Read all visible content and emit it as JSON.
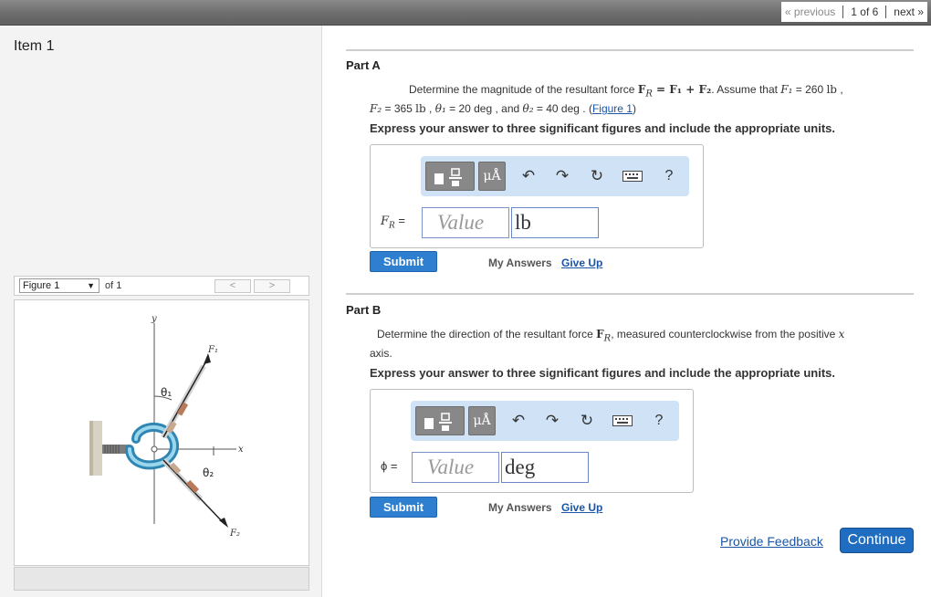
{
  "pager": {
    "previous": "« previous",
    "count": "1 of 6",
    "next": "next »"
  },
  "item": {
    "title": "Item 1"
  },
  "figure": {
    "select_value": "Figure 1",
    "of_label": "of 1",
    "prev": "<",
    "next": ">",
    "labels": {
      "y": "y",
      "x": "x",
      "f1": "F₁",
      "f2": "F₂",
      "theta1": "θ₁",
      "theta2": "θ₂"
    }
  },
  "partA": {
    "title": "Part A",
    "q": {
      "t1": "Determine the magnitude of the resultant force ",
      "eq": "F",
      "eq_sub": "R",
      "eq_rest": " = F₁ + F₂",
      "t2": ". Assume that ",
      "f1": "F₁",
      "t3": " = 260 ",
      "u1": "lb",
      "t4": " ,",
      "f2": "F₂",
      "t5": " = 365 ",
      "u2": "lb",
      "t6": " ,  ",
      "th1": "θ₁",
      "t7": " = 20 deg , and  ",
      "th2": "θ₂",
      "t8": " = 40 deg  .  (",
      "fig_link": "Figure 1",
      "t9": ")"
    },
    "instruction": "Express your answer to three significant figures and include the appropriate units.",
    "field_label": "F",
    "field_label_sub": "R",
    "field_label_eq": " =",
    "value_placeholder": "Value",
    "unit": "lb",
    "submit": "Submit",
    "my_answers": "My Answers",
    "give_up": "Give Up"
  },
  "partB": {
    "title": "Part B",
    "q": {
      "t1": "Determine the direction of the resultant force ",
      "f": "F",
      "f_sub": "R",
      "t2": ", measured counterclockwise from the positive ",
      "x": "x",
      "t3": "axis."
    },
    "instruction": "Express your answer to three significant figures and include the appropriate units.",
    "field_label": "ϕ =",
    "value_placeholder": "Value",
    "unit": "deg",
    "submit": "Submit",
    "my_answers": "My Answers",
    "give_up": "Give Up"
  },
  "toolbar": {
    "mu_label": "μÅ",
    "help": "?"
  },
  "footer": {
    "feedback": "Provide Feedback",
    "continue": "Continue"
  }
}
